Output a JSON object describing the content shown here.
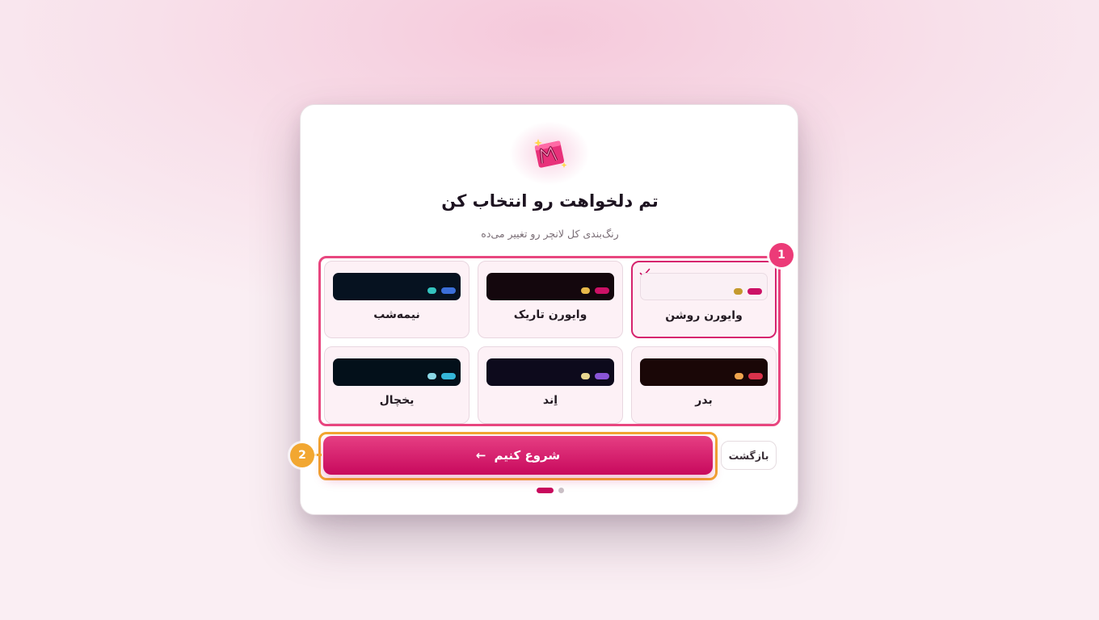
{
  "header": {
    "logo": "sparkle-m-logo",
    "title": "تم دلخواهت رو انتخاب کن",
    "subtitle": "رنگ‌بندی کل لانچر رو تغییر می‌ده"
  },
  "themes": [
    {
      "label": "وایورن روشن",
      "selected": true,
      "preview_bg": "#faf0f5",
      "accent": "#cc1166",
      "accent2": "#c49a2e"
    },
    {
      "label": "وایورن تاریک",
      "selected": false,
      "preview_bg": "#14070d",
      "accent": "#cc1166",
      "accent2": "#e8b84a"
    },
    {
      "label": "نیمه‌شب",
      "selected": false,
      "preview_bg": "#061220",
      "accent": "#3b6fd9",
      "accent2": "#34c4c0"
    },
    {
      "label": "بدر",
      "selected": false,
      "preview_bg": "#1a0707",
      "accent": "#d9324b",
      "accent2": "#f0a54e"
    },
    {
      "label": "اِند",
      "selected": false,
      "preview_bg": "#0d0a1c",
      "accent": "#8a55d6",
      "accent2": "#e8d690"
    },
    {
      "label": "یخچال",
      "selected": false,
      "preview_bg": "#03101a",
      "accent": "#35b6d8",
      "accent2": "#8ad8e6"
    }
  ],
  "actions": {
    "start_label": "شروع کنیم",
    "start_arrow": "←",
    "back_label": "بازگشت"
  },
  "annotations": {
    "badge_1": "1",
    "badge_2": "2"
  },
  "pagination": {
    "current": 1,
    "total": 2
  },
  "colors": {
    "primary": "#c8095d",
    "highlight_1": "#e8467f",
    "highlight_2": "#f2a731"
  }
}
